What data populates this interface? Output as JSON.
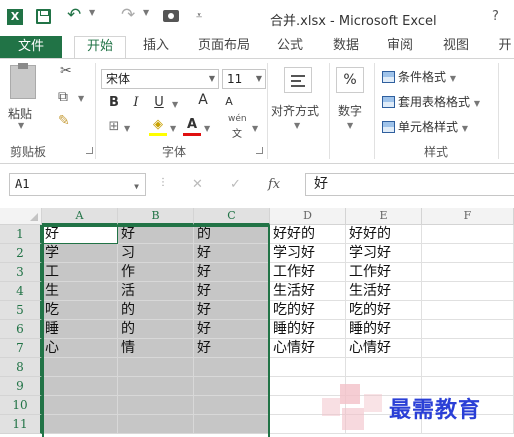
{
  "window": {
    "title": "合并.xlsx - Microsoft Excel",
    "app_icon_letter": "X",
    "help": "?"
  },
  "tabs": [
    "文件",
    "开始",
    "插入",
    "页面布局",
    "公式",
    "数据",
    "审阅",
    "视图",
    "开"
  ],
  "active_tab": "开始",
  "ribbon": {
    "clipboard": {
      "paste": "粘贴",
      "group": "剪贴板"
    },
    "font": {
      "name": "宋体",
      "size": "11",
      "bold": "B",
      "italic": "I",
      "underline": "U",
      "grow": "A",
      "shrink": "A",
      "font_color": "A",
      "phonetic": "wén",
      "phonetic_sub": "文",
      "group": "字体"
    },
    "alignment": {
      "label": "对齐方式"
    },
    "number": {
      "icon": "%",
      "label": "数字"
    },
    "styles": {
      "conditional": "条件格式",
      "table": "套用表格格式",
      "cell": "单元格样式",
      "group": "样式"
    },
    "accent_color": "#217346"
  },
  "formula_bar": {
    "cell_ref": "A1",
    "fx": "fx",
    "value": "好"
  },
  "grid": {
    "columns": [
      "A",
      "B",
      "C",
      "D",
      "E",
      "F"
    ],
    "rows": [
      "1",
      "2",
      "3",
      "4",
      "5",
      "6",
      "7",
      "8",
      "9",
      "10",
      "11"
    ],
    "cells": [
      [
        "好",
        "好",
        "的",
        "好好的",
        "好好的",
        ""
      ],
      [
        "学",
        "习",
        "好",
        "学习好",
        "学习好",
        ""
      ],
      [
        "工",
        "作",
        "好",
        "工作好",
        "工作好",
        ""
      ],
      [
        "生",
        "活",
        "好",
        "生活好",
        "生活好",
        ""
      ],
      [
        "吃",
        "的",
        "好",
        "吃的好",
        "吃的好",
        ""
      ],
      [
        "睡",
        "的",
        "好",
        "睡的好",
        "睡的好",
        ""
      ],
      [
        "心",
        "情",
        "好",
        "心情好",
        "心情好",
        ""
      ],
      [
        "",
        "",
        "",
        "",
        "",
        ""
      ],
      [
        "",
        "",
        "",
        "",
        "",
        ""
      ],
      [
        "",
        "",
        "",
        "",
        "",
        ""
      ],
      [
        "",
        "",
        "",
        "",
        "",
        ""
      ]
    ],
    "selected_range": "A1:C11",
    "selection_fill": "#c6c6c6"
  },
  "watermark": {
    "text": "最需教育"
  }
}
